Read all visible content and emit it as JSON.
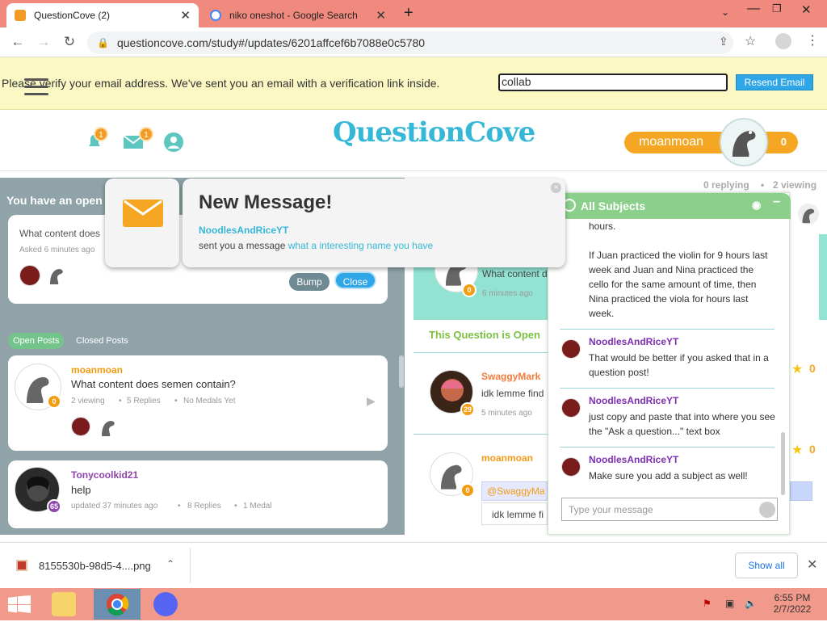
{
  "browser": {
    "tabs": [
      {
        "title": "QuestionCove (2)",
        "active": true
      },
      {
        "title": "niko oneshot - Google Search",
        "active": false
      }
    ],
    "new_tab_glyph": "+",
    "url": "questioncove.com/study#/updates/6201affcef6b7088e0c5780"
  },
  "verify_bar": {
    "message": "Please verify your email address. We've sent you an email with a verification link inside.",
    "input_value": "collab",
    "resend_label": "Resend Email"
  },
  "header": {
    "bell_count": "1",
    "mail_count": "1",
    "logo": "QuestionCove",
    "username": "moanmoan",
    "score": "0"
  },
  "left": {
    "open_heading": "You have an open question",
    "open_question_text": "What content does",
    "open_question_meta": "Asked 6 minutes ago",
    "bump_label": "Bump",
    "close_label": "Close",
    "tabs": [
      "Open Posts",
      "Closed Posts"
    ],
    "posts": [
      {
        "user": "moanmoan",
        "text": "What content does semen contain?",
        "viewing": "2 viewing",
        "replies": "5 Replies",
        "medals": "No Medals Yet",
        "level": "0"
      },
      {
        "user": "Tonycoolkid21",
        "text": "help",
        "viewing": "updated 37 minutes ago",
        "replies": "8 Replies",
        "medals": "1 Medal",
        "level": "65"
      }
    ]
  },
  "notification": {
    "title": "New Message!",
    "sender": "NoodlesAndRiceYT",
    "prefix": "sent you a message",
    "message": "what a interesting name you have"
  },
  "middle": {
    "replying": "0 replying",
    "viewing": "2 viewing",
    "question_text": "What content d",
    "question_meta": "6 minutes ago",
    "status": "This Question is Open",
    "replies": [
      {
        "user": "SwaggyMark",
        "text": "idk lemme find",
        "meta": "5 minutes ago",
        "level": "29",
        "medal_count": "0"
      },
      {
        "user": "moanmoan",
        "mention": "@SwaggyMa",
        "quote": "idk lemme fi",
        "level": "0",
        "medal_count": "0"
      }
    ]
  },
  "chat": {
    "title": "All Subjects",
    "context_text": "hours.\n\nIf Juan practiced the violin for 9 hours last week and Juan and Nina practiced the cello for the same amount of time, then Nina practiced the viola for  hours last week.",
    "messages": [
      {
        "user": "NoodlesAndRiceYT",
        "text": "That would be better if you asked that in a question post!"
      },
      {
        "user": "NoodlesAndRiceYT",
        "text": "just copy and paste that into where you see the \"Ask a question...\" text box"
      },
      {
        "user": "NoodlesAndRiceYT",
        "text": "Make sure you add a subject as well!"
      }
    ],
    "input_placeholder": "Type your message"
  },
  "downloads": {
    "file": "8155530b-98d5-4....png",
    "show_all": "Show all"
  },
  "taskbar": {
    "time": "6:55 PM",
    "date": "2/7/2022"
  },
  "colors": {
    "accent_blue": "#35b7d7",
    "orange": "#f5a623",
    "chat_green": "#8bcf8b",
    "username_purple": "#7d2fb3"
  }
}
